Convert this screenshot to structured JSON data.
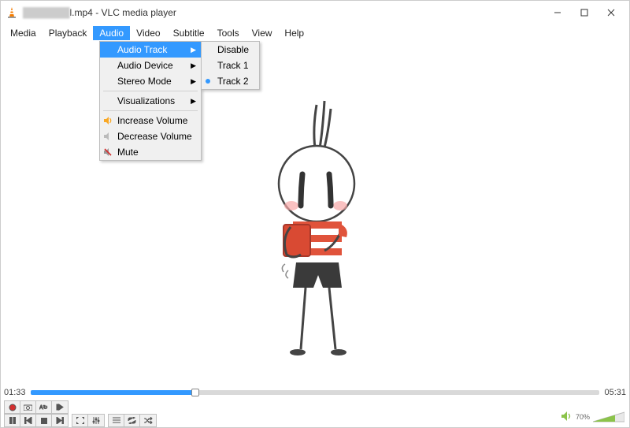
{
  "titlebar": {
    "filename": "l.mp4",
    "suffix": " - VLC media player"
  },
  "menubar": [
    "Media",
    "Playback",
    "Audio",
    "Video",
    "Subtitle",
    "Tools",
    "View",
    "Help"
  ],
  "audio_menu": {
    "items": [
      {
        "label": "Audio Track",
        "arrow": true,
        "hl": true
      },
      {
        "label": "Audio Device",
        "arrow": true
      },
      {
        "label": "Stereo Mode",
        "arrow": true
      },
      "sep",
      {
        "label": "Visualizations",
        "arrow": true
      },
      "sep",
      {
        "label": "Increase Volume",
        "icon": "vol-up"
      },
      {
        "label": "Decrease Volume",
        "icon": "vol-down"
      },
      {
        "label": "Mute",
        "icon": "mute"
      }
    ]
  },
  "audio_track_submenu": [
    {
      "label": "Disable"
    },
    {
      "label": "Track 1"
    },
    {
      "label": "Track 2",
      "sel": true
    }
  ],
  "time": {
    "current": "01:33",
    "total": "05:31"
  },
  "volume": {
    "percent": "70%"
  }
}
